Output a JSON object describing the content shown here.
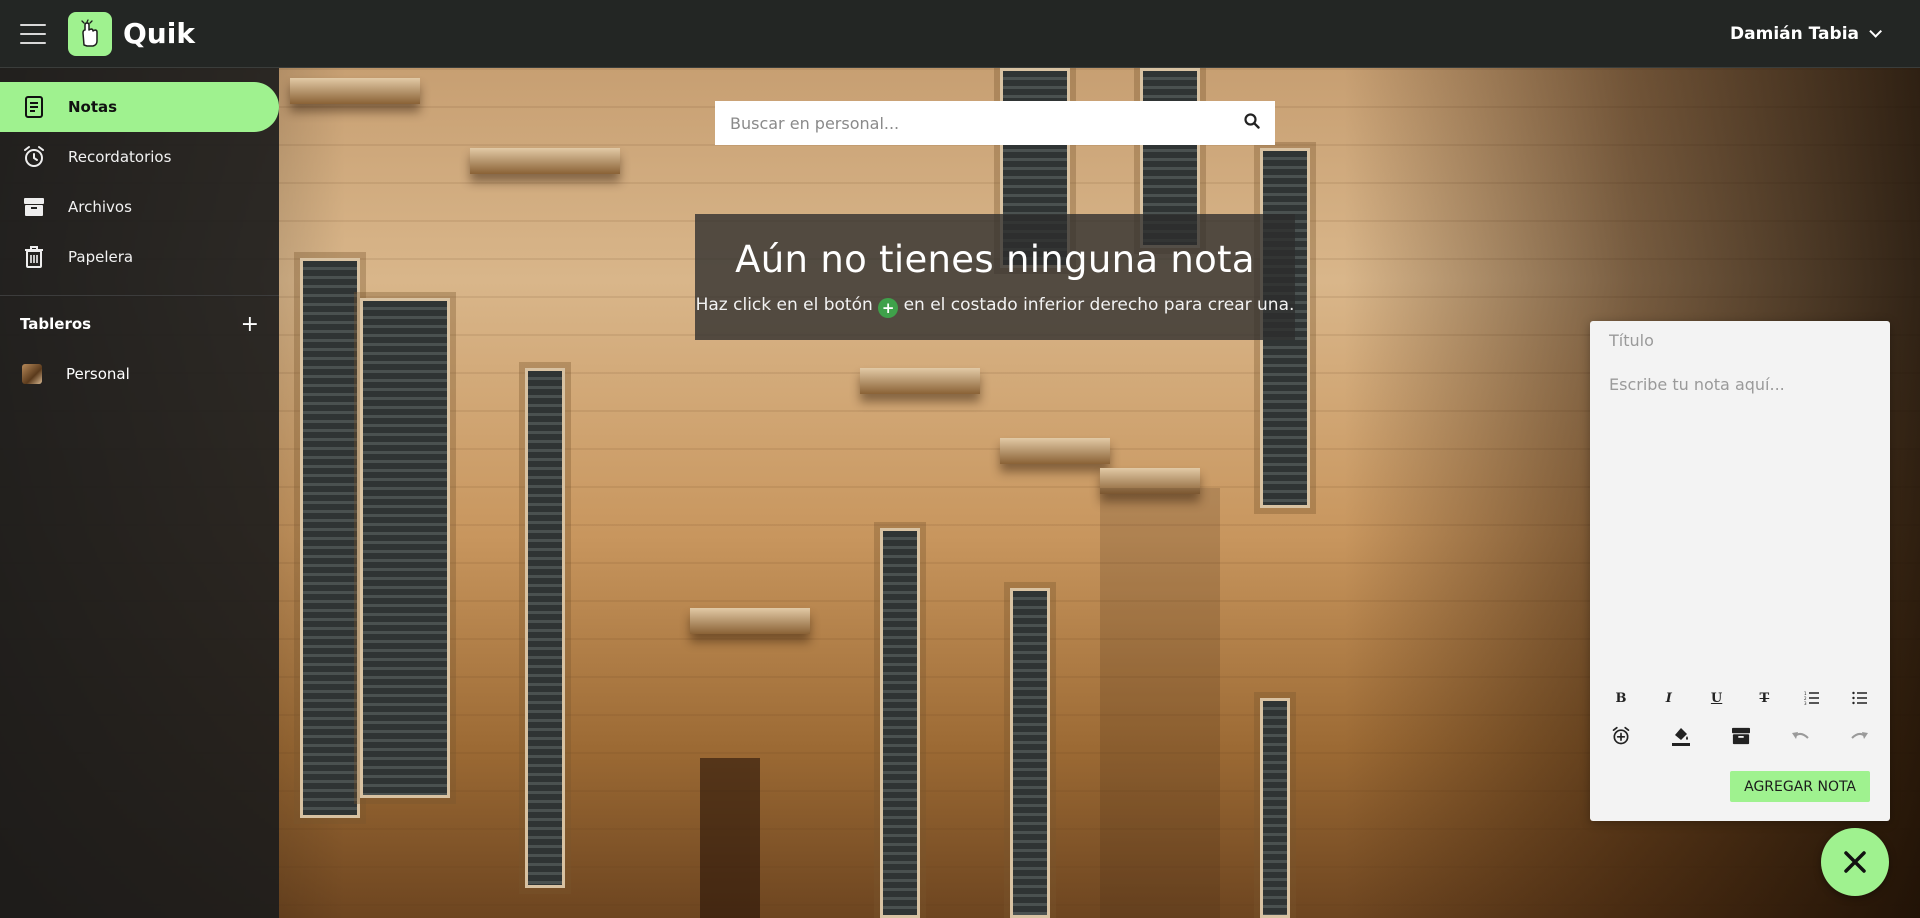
{
  "app": {
    "name": "Quik"
  },
  "header": {
    "user_name": "Damián Tabia"
  },
  "sidebar": {
    "items": [
      {
        "label": "Notas",
        "icon": "note-icon",
        "active": true
      },
      {
        "label": "Recordatorios",
        "icon": "alarm-icon",
        "active": false
      },
      {
        "label": "Archivos",
        "icon": "archive-icon",
        "active": false
      },
      {
        "label": "Papelera",
        "icon": "trash-icon",
        "active": false
      }
    ],
    "boards_title": "Tableros",
    "boards": [
      {
        "label": "Personal"
      }
    ]
  },
  "search": {
    "placeholder": "Buscar en personal..."
  },
  "empty_state": {
    "title": "Aún no tienes ninguna nota",
    "message_before": "Haz click en el botón",
    "message_after": "en el costado inferior derecho para crear una."
  },
  "composer": {
    "title_placeholder": "Título",
    "body_placeholder": "Escribe tu nota aquí...",
    "format_buttons": [
      "bold-icon",
      "italic-icon",
      "underline-icon",
      "strikethrough-icon",
      "ordered-list-icon",
      "unordered-list-icon"
    ],
    "action_buttons": [
      "reminder-icon",
      "fill-color-icon",
      "archive-icon",
      "undo-icon",
      "redo-icon"
    ],
    "submit_label": "AGREGAR NOTA"
  },
  "colors": {
    "accent": "#9ff28f",
    "topbar": "#232624",
    "sidebar": "#1c1c1c"
  }
}
